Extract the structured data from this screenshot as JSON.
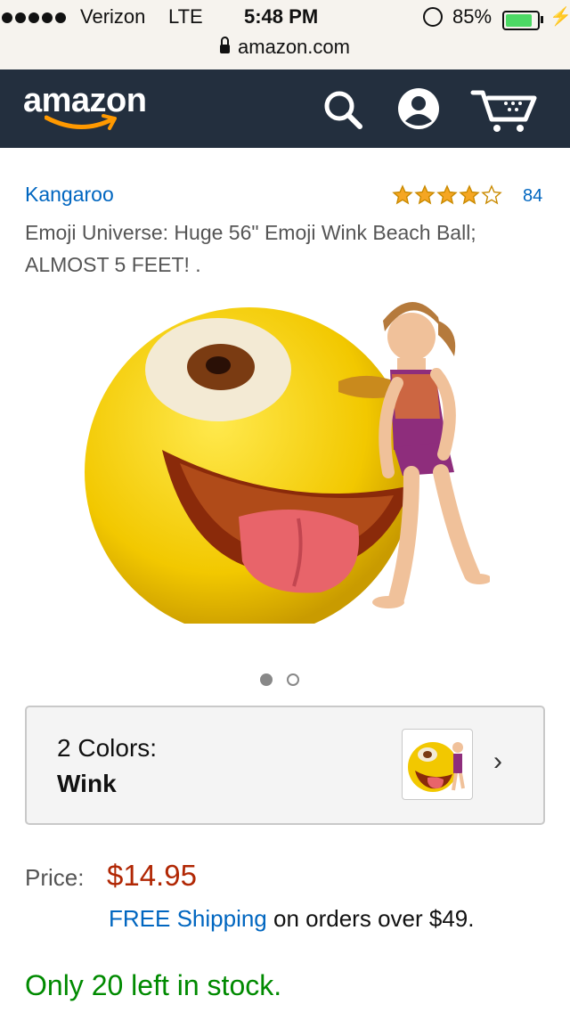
{
  "status_bar": {
    "carrier": "Verizon",
    "network": "LTE",
    "time": "5:48 PM",
    "battery_percent": "85%",
    "battery_level": 0.85,
    "url": "amazon.com"
  },
  "nav": {
    "logo": "amazon",
    "icons": [
      "search-icon",
      "account-icon",
      "cart-icon"
    ],
    "colors": {
      "background": "#232f3e",
      "smile": "#ff9900"
    }
  },
  "product": {
    "brand": "Kangaroo",
    "rating": 4,
    "rating_max": 5,
    "review_count": "84",
    "title": "Emoji Universe: Huge 56\" Emoji Wink Beach Ball; ALMOST 5 FEET! .",
    "image_count": 2,
    "active_image": 1
  },
  "variation": {
    "label": "2 Colors:",
    "value": "Wink"
  },
  "pricing": {
    "price_label": "Price:",
    "price": "$14.95",
    "shipping_link": "FREE Shipping",
    "shipping_text": "on orders over $49."
  },
  "availability": {
    "stock": "Only 20 left in stock."
  },
  "colors": {
    "link": "#0066c0",
    "price": "#b12704",
    "stock": "#008a00",
    "star": "#f5a623"
  }
}
